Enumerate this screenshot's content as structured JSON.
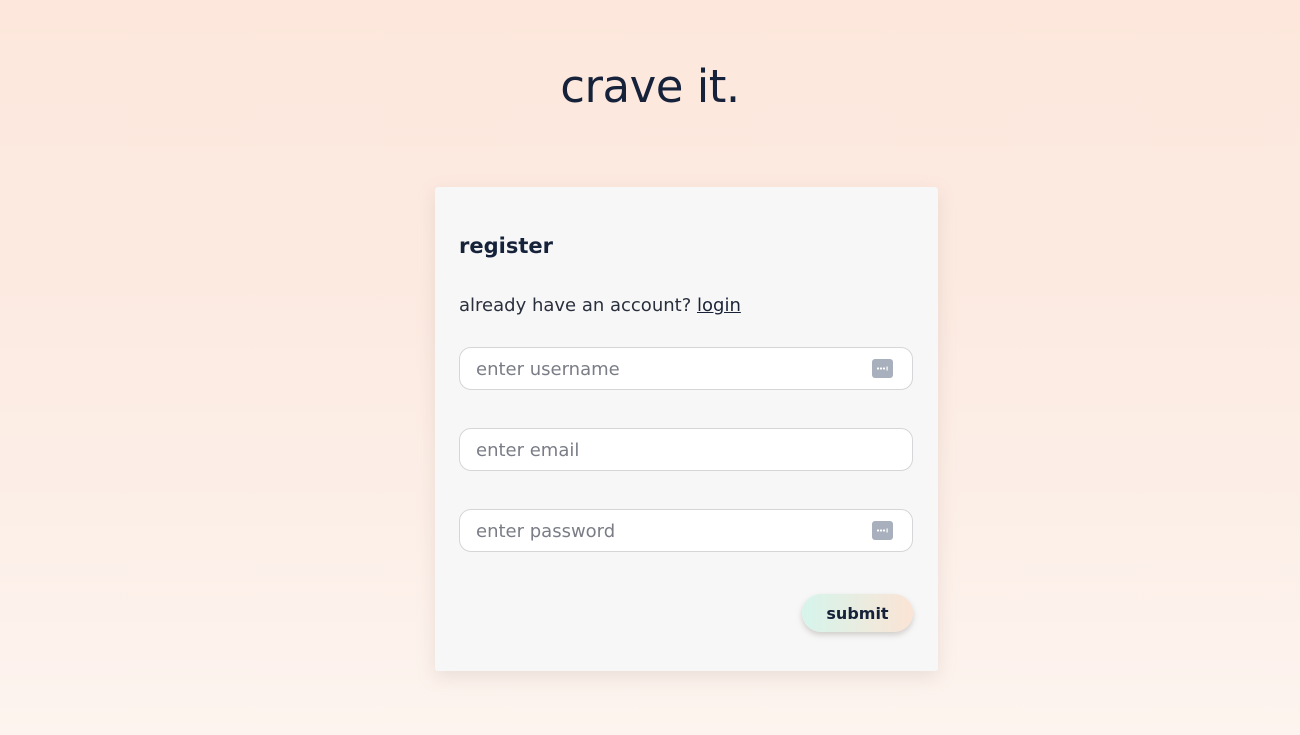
{
  "brand": {
    "title": "crave it."
  },
  "form": {
    "heading": "register",
    "prompt_text": "already have an account?",
    "login_link": "login",
    "fields": {
      "username": {
        "placeholder": "enter username",
        "value": "",
        "icon": "password-manager-icon"
      },
      "email": {
        "placeholder": "enter email",
        "value": ""
      },
      "password": {
        "placeholder": "enter password",
        "value": "",
        "icon": "password-manager-icon"
      }
    },
    "submit_label": "submit"
  },
  "colors": {
    "text": "#16213a",
    "card": "#f7f7f7",
    "background_top": "#fde7dc",
    "background_bottom": "#fdf4ef",
    "button_gradient_start": "#d6f5ec",
    "button_gradient_end": "#fbe4d5",
    "icon": "#a9b0bd"
  }
}
